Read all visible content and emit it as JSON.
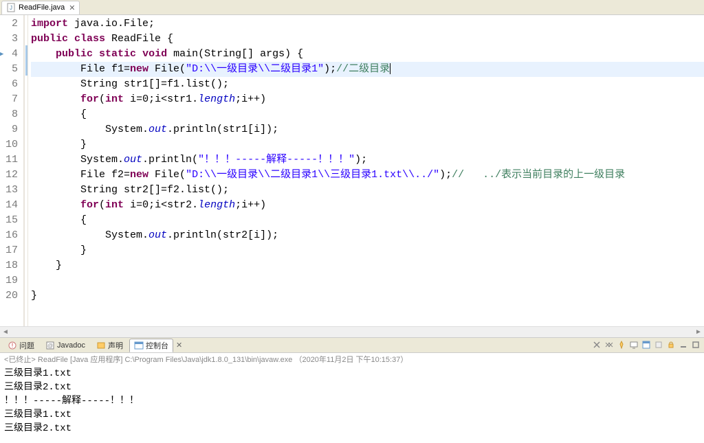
{
  "editor": {
    "tab": {
      "label": "ReadFile.java"
    },
    "lines": [
      {
        "num": 2,
        "tokens": [
          {
            "t": "kw",
            "v": "import"
          },
          {
            "t": "",
            "v": " java.io.File;"
          }
        ]
      },
      {
        "num": 3,
        "tokens": [
          {
            "t": "kw",
            "v": "public"
          },
          {
            "t": "",
            "v": " "
          },
          {
            "t": "kw",
            "v": "class"
          },
          {
            "t": "",
            "v": " ReadFile {"
          }
        ]
      },
      {
        "num": 4,
        "marked": true,
        "tokens": [
          {
            "t": "",
            "v": "    "
          },
          {
            "t": "kw",
            "v": "public"
          },
          {
            "t": "",
            "v": " "
          },
          {
            "t": "kw",
            "v": "static"
          },
          {
            "t": "",
            "v": " "
          },
          {
            "t": "kw",
            "v": "void"
          },
          {
            "t": "",
            "v": " main(String[] args) {"
          }
        ]
      },
      {
        "num": 5,
        "current": true,
        "tokens": [
          {
            "t": "",
            "v": "        File f1="
          },
          {
            "t": "kw",
            "v": "new"
          },
          {
            "t": "",
            "v": " File("
          },
          {
            "t": "str",
            "v": "\"D:\\\\一级目录\\\\二级目录1\""
          },
          {
            "t": "",
            "v": ");"
          },
          {
            "t": "cmt",
            "v": "//二级目录"
          }
        ],
        "cursor": true
      },
      {
        "num": 6,
        "tokens": [
          {
            "t": "",
            "v": "        String str1[]=f1.list();"
          }
        ]
      },
      {
        "num": 7,
        "tokens": [
          {
            "t": "",
            "v": "        "
          },
          {
            "t": "kw",
            "v": "for"
          },
          {
            "t": "",
            "v": "("
          },
          {
            "t": "kw",
            "v": "int"
          },
          {
            "t": "",
            "v": " i=0;i<str1."
          },
          {
            "t": "field",
            "v": "length"
          },
          {
            "t": "",
            "v": ";i++)"
          }
        ]
      },
      {
        "num": 8,
        "tokens": [
          {
            "t": "",
            "v": "        {"
          }
        ]
      },
      {
        "num": 9,
        "tokens": [
          {
            "t": "",
            "v": "            System."
          },
          {
            "t": "field",
            "v": "out"
          },
          {
            "t": "",
            "v": ".println(str1[i]);"
          }
        ]
      },
      {
        "num": 10,
        "tokens": [
          {
            "t": "",
            "v": "        }"
          }
        ]
      },
      {
        "num": 11,
        "tokens": [
          {
            "t": "",
            "v": "        System."
          },
          {
            "t": "field",
            "v": "out"
          },
          {
            "t": "",
            "v": ".println("
          },
          {
            "t": "str",
            "v": "\"！！！-----解释-----！！！\""
          },
          {
            "t": "",
            "v": ");"
          }
        ]
      },
      {
        "num": 12,
        "tokens": [
          {
            "t": "",
            "v": "        File f2="
          },
          {
            "t": "kw",
            "v": "new"
          },
          {
            "t": "",
            "v": " File("
          },
          {
            "t": "str",
            "v": "\"D:\\\\一级目录\\\\二级目录1\\\\三级目录1.txt\\\\../\""
          },
          {
            "t": "",
            "v": ");"
          },
          {
            "t": "cmt",
            "v": "//   ../表示当前目录的上一级目录"
          }
        ]
      },
      {
        "num": 13,
        "tokens": [
          {
            "t": "",
            "v": "        String str2[]=f2.list();"
          }
        ]
      },
      {
        "num": 14,
        "tokens": [
          {
            "t": "",
            "v": "        "
          },
          {
            "t": "kw",
            "v": "for"
          },
          {
            "t": "",
            "v": "("
          },
          {
            "t": "kw",
            "v": "int"
          },
          {
            "t": "",
            "v": " i=0;i<str2."
          },
          {
            "t": "field",
            "v": "length"
          },
          {
            "t": "",
            "v": ";i++)"
          }
        ]
      },
      {
        "num": 15,
        "tokens": [
          {
            "t": "",
            "v": "        {"
          }
        ]
      },
      {
        "num": 16,
        "tokens": [
          {
            "t": "",
            "v": "            System."
          },
          {
            "t": "field",
            "v": "out"
          },
          {
            "t": "",
            "v": ".println(str2[i]);"
          }
        ]
      },
      {
        "num": 17,
        "tokens": [
          {
            "t": "",
            "v": "        }"
          }
        ]
      },
      {
        "num": 18,
        "tokens": [
          {
            "t": "",
            "v": "    }"
          }
        ]
      },
      {
        "num": 19,
        "tokens": [
          {
            "t": "",
            "v": ""
          }
        ]
      },
      {
        "num": 20,
        "tokens": [
          {
            "t": "",
            "v": "}"
          }
        ]
      }
    ]
  },
  "panel": {
    "tabs": [
      {
        "label": "问题",
        "icon": "problems-icon"
      },
      {
        "label": "Javadoc",
        "icon": "javadoc-icon"
      },
      {
        "label": "声明",
        "icon": "declaration-icon"
      },
      {
        "label": "控制台",
        "icon": "console-icon",
        "active": true
      }
    ],
    "toolbar_icons": [
      "remove-icon",
      "remove-all-icon",
      "pin-icon",
      "display-icon",
      "open-console-icon",
      "clear-icon",
      "scroll-lock-icon",
      "minimize-icon",
      "maximize-icon"
    ],
    "status": "<已终止> ReadFile [Java 应用程序] C:\\Program Files\\Java\\jdk1.8.0_131\\bin\\javaw.exe （2020年11月2日 下午10:15:37）",
    "output": [
      "三级目录1.txt",
      "三级目录2.txt",
      "！！！-----解释-----！！！",
      "三级目录1.txt",
      "三级目录2.txt"
    ]
  }
}
